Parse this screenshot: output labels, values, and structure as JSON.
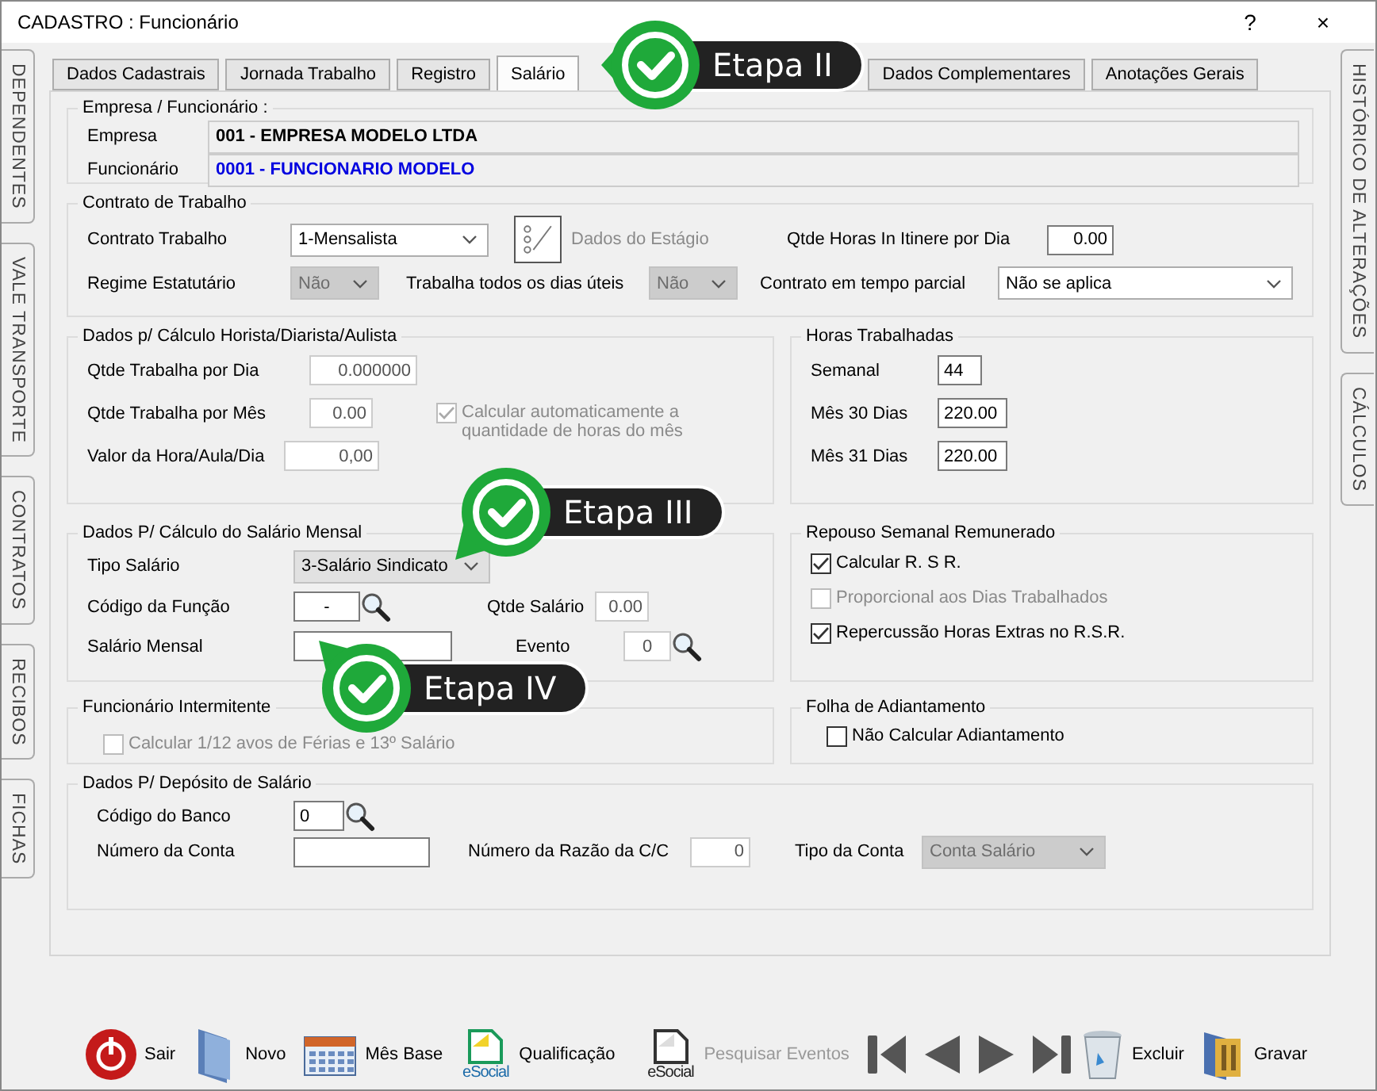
{
  "window": {
    "title": "CADASTRO : Funcionário",
    "help": "?",
    "close": "×"
  },
  "left_tabs": [
    {
      "label": "DEPENDENTES"
    },
    {
      "label": "VALE TRANSPORTE"
    },
    {
      "label": "CONTRATOS"
    },
    {
      "label": "RECIBOS"
    },
    {
      "label": "FICHAS"
    }
  ],
  "right_tabs": [
    {
      "label": "HISTÓRICO DE ALTERAÇÕES"
    },
    {
      "label": "CÁLCULOS"
    }
  ],
  "tabs": [
    {
      "label": "Dados Cadastrais",
      "selected": false
    },
    {
      "label": "Jornada Trabalho",
      "selected": false
    },
    {
      "label": "Registro",
      "selected": false
    },
    {
      "label": "Salário",
      "selected": true
    },
    {
      "label": "Dados Complementares",
      "selected": false
    },
    {
      "label": "Anotações Gerais",
      "selected": false
    }
  ],
  "empresa_funcionario": {
    "title": "Empresa / Funcionário :",
    "empresa_label": "Empresa",
    "empresa": "001 - EMPRESA MODELO LTDA",
    "funcionario_label": "Funcionário",
    "funcionario": "0001 - FUNCIONARIO MODELO"
  },
  "contrato": {
    "title": "Contrato de Trabalho",
    "contrato_trabalho": {
      "label": "Contrato Trabalho",
      "value": "1-Mensalista",
      "disabled": false
    },
    "dados_estagio": {
      "label": "Dados do Estágio",
      "disabled": true
    },
    "horas_itinere": {
      "label": "Qtde Horas In Itinere por Dia",
      "value": "0.00",
      "disabled": false
    },
    "regime_estatutario": {
      "label": "Regime Estatutário",
      "value": "Não",
      "disabled": true
    },
    "dias_uteis": {
      "label": "Trabalha todos os dias úteis",
      "value": "Não",
      "disabled": true
    },
    "tempo_parcial": {
      "label": "Contrato em tempo parcial",
      "value": "Não se aplica",
      "disabled": false
    }
  },
  "horista": {
    "title": "Dados p/ Cálculo Horista/Diarista/Aulista",
    "fields": [
      {
        "label": "Qtde Trabalha por Dia",
        "value": "0.000000",
        "disabled": true
      },
      {
        "label": "Qtde Trabalha por Mês",
        "value": "0.00",
        "disabled": true
      },
      {
        "label": "Valor da Hora/Aula/Dia",
        "value": "0,00",
        "disabled": true
      }
    ],
    "auto_calc": {
      "label": "Calcular automaticamente a quantidade de horas do mês",
      "checked": true,
      "disabled": true
    }
  },
  "horas_trabalhadas": {
    "title": "Horas Trabalhadas",
    "fields": [
      {
        "label": "Semanal",
        "value": "44"
      },
      {
        "label": "Mês 30 Dias",
        "value": "220.00"
      },
      {
        "label": "Mês 31 Dias",
        "value": "220.00"
      }
    ]
  },
  "salario_mensal": {
    "title": "Dados P/ Cálculo do Salário Mensal",
    "tipo_salario": {
      "label": "Tipo Salário",
      "value": "3-Salário Sindicato",
      "disabled": true
    },
    "codigo_funcao": {
      "label": "Código da Função",
      "value": "-",
      "disabled": false
    },
    "qtde_salario": {
      "label": "Qtde Salário",
      "value": "0.00",
      "disabled": true
    },
    "salario_mensal": {
      "label": "Salário Mensal",
      "disabled": false
    },
    "evento": {
      "label": "Evento",
      "value": "0",
      "disabled": true
    }
  },
  "rsr": {
    "title": "Repouso Semanal Remunerado",
    "options": [
      {
        "label": "Calcular R. S R.",
        "checked": true,
        "disabled": false
      },
      {
        "label": "Proporcional aos Dias Trabalhados",
        "checked": false,
        "disabled": true
      },
      {
        "label": "Repercussão Horas Extras no R.S.R.",
        "checked": true,
        "disabled": false
      }
    ]
  },
  "intermitente": {
    "title": "Funcionário Intermitente",
    "option": {
      "label": "Calcular 1/12 avos de Férias e 13º Salário",
      "checked": false,
      "disabled": true
    }
  },
  "adiantamento": {
    "title": "Folha de Adiantamento",
    "option": {
      "label": "Não Calcular Adiantamento",
      "checked": false,
      "disabled": false
    }
  },
  "deposito": {
    "title": "Dados P/ Depósito de Salário",
    "codigo_banco": {
      "label": "Código do Banco",
      "value": "0",
      "disabled": false
    },
    "numero_conta": {
      "label": "Número da Conta",
      "disabled": false
    },
    "razao": {
      "label": "Número da Razão da C/C",
      "value": "0",
      "disabled": true
    },
    "tipo_conta": {
      "label": "Tipo da Conta",
      "value": "Conta Salário",
      "disabled": true
    }
  },
  "callouts": [
    {
      "label": "Etapa II"
    },
    {
      "label": "Etapa III"
    },
    {
      "label": "Etapa IV"
    }
  ],
  "toolbar": [
    {
      "kind": "exit",
      "label": "Sair",
      "disabled": false
    },
    {
      "kind": "new",
      "label": "Novo",
      "disabled": false
    },
    {
      "kind": "calendar",
      "label": "Mês Base",
      "disabled": false
    },
    {
      "kind": "esocial",
      "label": "Qualificação",
      "logo": "eSocial",
      "disabled": false
    },
    {
      "kind": "esocial-gray",
      "label": "Pesquisar Eventos",
      "logo": "eSocial",
      "disabled": true
    },
    {
      "kind": "first"
    },
    {
      "kind": "prev"
    },
    {
      "kind": "next"
    },
    {
      "kind": "last"
    },
    {
      "kind": "trash",
      "label": "Excluir",
      "disabled": false
    },
    {
      "kind": "save",
      "label": "Gravar",
      "disabled": false
    }
  ]
}
